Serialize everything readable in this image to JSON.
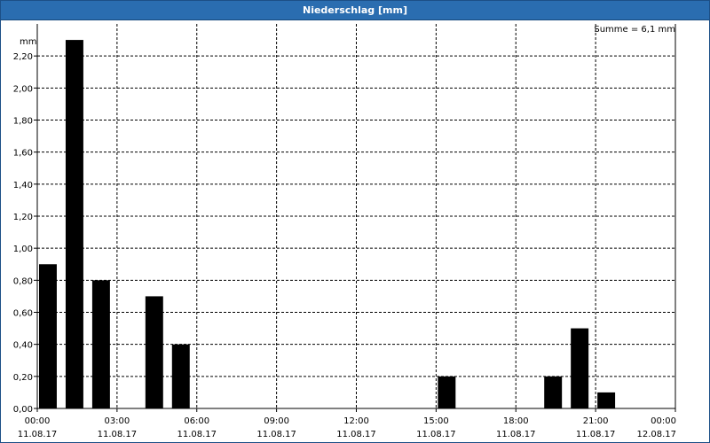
{
  "window": {
    "title": "Niederschlag [mm]"
  },
  "chart_data": {
    "type": "bar",
    "title": "Niederschlag [mm]",
    "ylabel": "mm",
    "ylim": [
      0,
      2.4
    ],
    "yticks": [
      "0,00",
      "0,20",
      "0,40",
      "0,60",
      "0,80",
      "1,00",
      "1,20",
      "1,40",
      "1,60",
      "1,80",
      "2,00",
      "2,20"
    ],
    "xlim_hours": [
      0,
      24
    ],
    "xticks": [
      {
        "time": "00:00",
        "date": "11.08.17"
      },
      {
        "time": "03:00",
        "date": "11.08.17"
      },
      {
        "time": "06:00",
        "date": "11.08.17"
      },
      {
        "time": "09:00",
        "date": "11.08.17"
      },
      {
        "time": "12:00",
        "date": "11.08.17"
      },
      {
        "time": "15:00",
        "date": "11.08.17"
      },
      {
        "time": "18:00",
        "date": "11.08.17"
      },
      {
        "time": "21:00",
        "date": "11.08.17"
      },
      {
        "time": "00:00",
        "date": "12.08.17"
      }
    ],
    "bars": [
      {
        "hour": 0,
        "value": 0.9
      },
      {
        "hour": 1,
        "value": 2.3
      },
      {
        "hour": 2,
        "value": 0.8
      },
      {
        "hour": 4,
        "value": 0.7
      },
      {
        "hour": 5,
        "value": 0.4
      },
      {
        "hour": 15,
        "value": 0.2
      },
      {
        "hour": 19,
        "value": 0.2
      },
      {
        "hour": 20,
        "value": 0.5
      },
      {
        "hour": 21,
        "value": 0.1
      }
    ],
    "grid": true,
    "bar_color": "#000000",
    "sum_label": "Summe = 6,1 mm"
  }
}
